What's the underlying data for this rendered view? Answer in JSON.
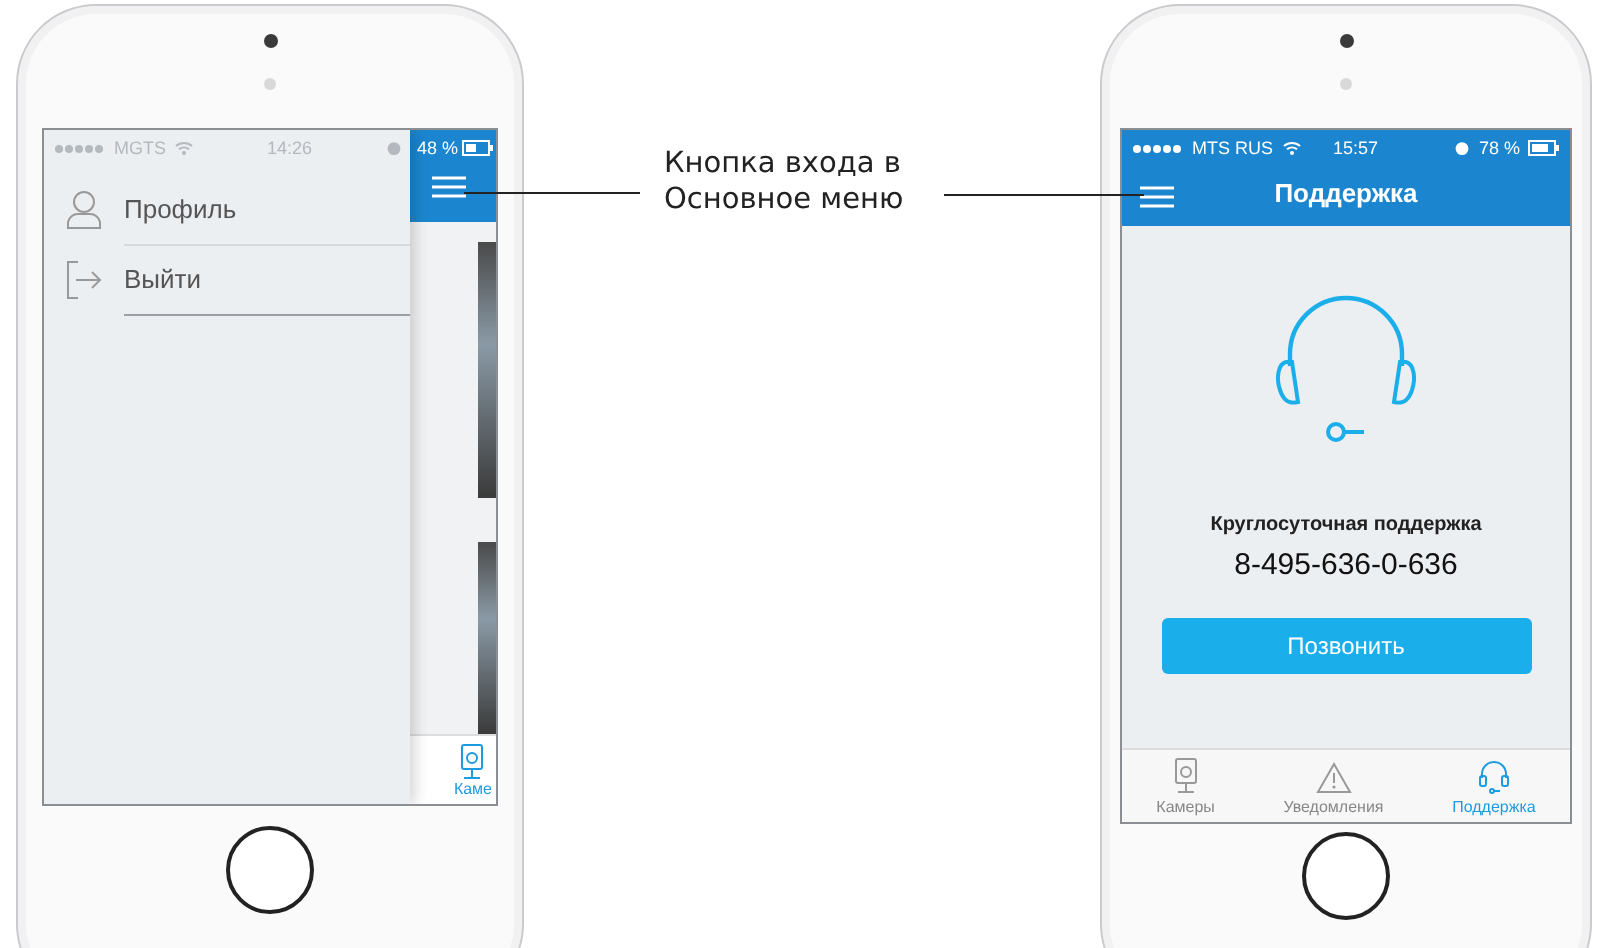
{
  "annotation": {
    "text": "Кнопка входа в\nОсновное меню"
  },
  "menu_phone": {
    "status_bar": {
      "carrier": "MGTS",
      "time": "14:26",
      "battery": "48 %"
    },
    "menu_items": [
      {
        "label": "Профиль",
        "kind": "profile"
      },
      {
        "label": "Выйти",
        "kind": "logout"
      }
    ],
    "tab_label": "Каме"
  },
  "support_phone": {
    "status_bar": {
      "carrier": "MTS RUS",
      "time": "15:57",
      "battery": "78 %"
    },
    "title": "Поддержка",
    "support_title": "Круглосуточная поддержка",
    "phone_number": "8-495-636-0-636",
    "call_button": "Позвонить",
    "tabs": [
      {
        "label": "Камеры",
        "kind": "camera",
        "selected": false
      },
      {
        "label": "Уведомления",
        "kind": "alert",
        "selected": false
      },
      {
        "label": "Поддержка",
        "kind": "headset",
        "selected": true
      }
    ]
  }
}
